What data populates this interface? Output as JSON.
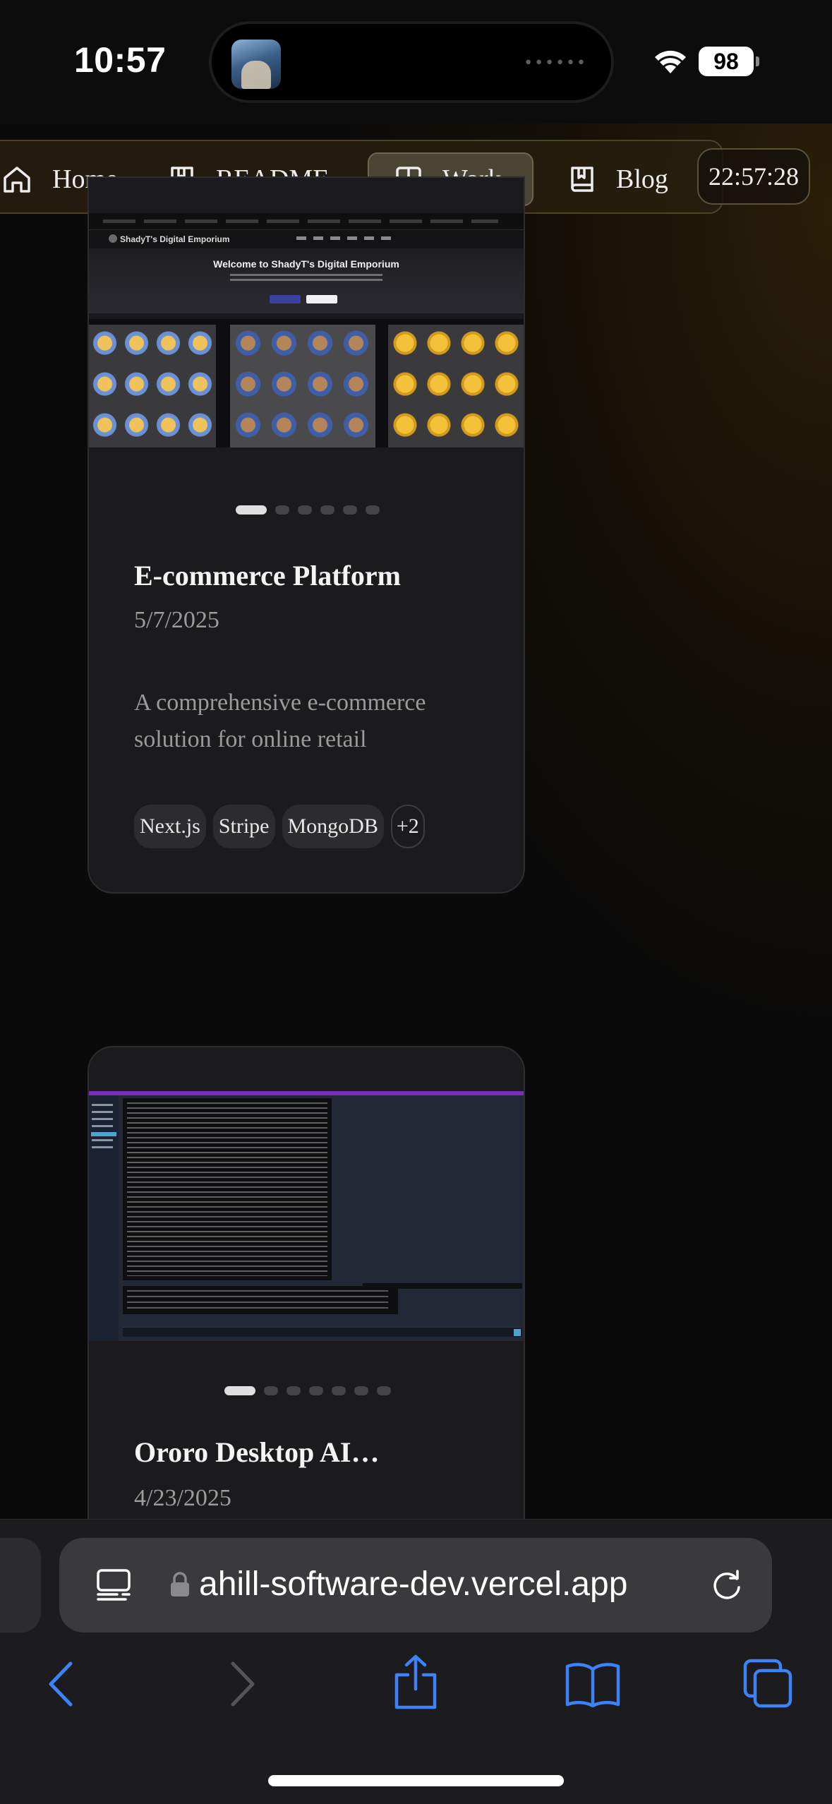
{
  "status_bar": {
    "time": "10:57",
    "battery": "98"
  },
  "nav": {
    "items": [
      {
        "label": "Home"
      },
      {
        "label": "README"
      },
      {
        "label": "Work",
        "active": true
      },
      {
        "label": "Blog"
      }
    ],
    "clock": "22:57:28"
  },
  "projects": [
    {
      "title": "E-commerce Platform",
      "date": "5/7/2025",
      "description": "A comprehensive e-commerce solution for online retail",
      "tags": [
        "Next.js",
        "Stripe",
        "MongoDB",
        "+2"
      ],
      "screenshot": {
        "brand": "ShadyT's Digital Emporium",
        "hero_title": "Welcome to ShadyT's Digital Emporium"
      },
      "carousel": {
        "count": 6,
        "active": 0
      }
    },
    {
      "title": "Ororo Desktop AI…",
      "date": "4/23/2025",
      "carousel": {
        "count": 7,
        "active": 0
      }
    }
  ],
  "browser": {
    "url": "ahill-software-dev.vercel.app"
  },
  "colors": {
    "accent_nav_active": "#4a4433",
    "link_blue": "#3d82f6",
    "card_bg": "#1b1b1d"
  }
}
